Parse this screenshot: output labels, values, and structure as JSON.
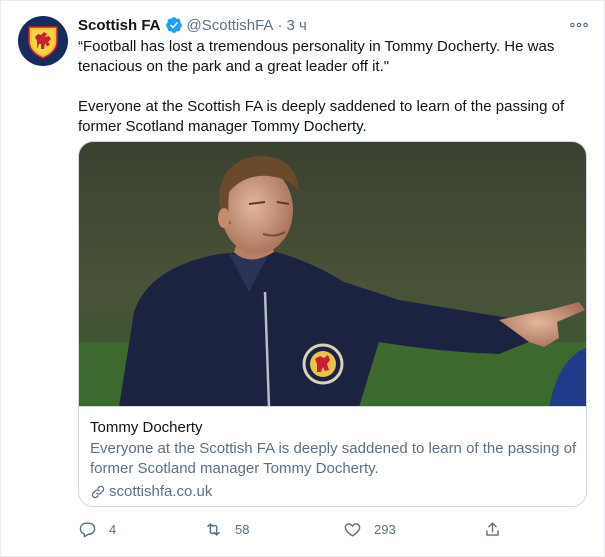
{
  "account": {
    "name": "Scottish FA",
    "handle": "@ScottishFA",
    "separator": "·",
    "time": "3 ч",
    "avatar_icon": "scottish-fa-crest",
    "verified_icon": "verified-badge-icon"
  },
  "tweet": {
    "paragraph1": "“Football has lost a tremendous personality in Tommy Docherty. He was tenacious on the park and a great leader off it.\"",
    "paragraph2": "Everyone at the Scottish FA is deeply saddened to learn of the passing of former Scotland manager Tommy Docherty."
  },
  "card": {
    "title": "Tommy Docherty",
    "description": "Everyone at the Scottish FA is deeply saddened to learn of the passing of former Scotland manager Tommy Docherty.",
    "domain": "scottishfa.co.uk",
    "image": "photo-of-tommy-docherty-pointing"
  },
  "actions": {
    "replies": "4",
    "retweets": "58",
    "likes": "293"
  },
  "colors": {
    "verified": "#1da1f2",
    "secondary_text": "#5b7083",
    "border": "#cfd9de"
  }
}
